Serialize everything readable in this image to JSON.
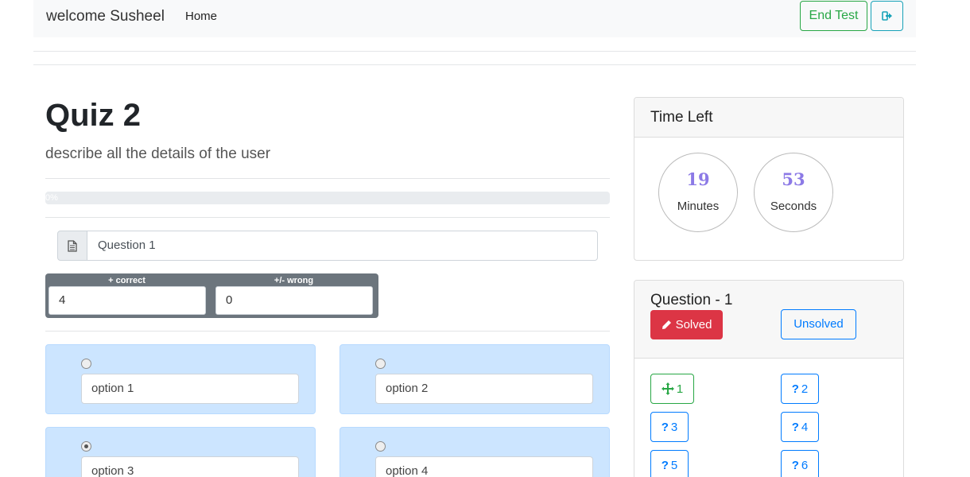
{
  "navbar": {
    "brand": "welcome Susheel",
    "home": "Home",
    "end_test": "End Test",
    "logout_icon": "sign-out-icon"
  },
  "quiz": {
    "title": "Quiz 2",
    "description": "describe all the details of the user",
    "progress_label": "0%",
    "progress_value": 0,
    "question_icon": "document-icon",
    "question_title": "Question 1",
    "correct_label": "+ correct",
    "correct_value": "4",
    "wrong_label": "+/- wrong",
    "wrong_value": "0",
    "options": [
      {
        "label": "option 1",
        "selected": false
      },
      {
        "label": "option 2",
        "selected": false
      },
      {
        "label": "option 3",
        "selected": true
      },
      {
        "label": "option 4",
        "selected": false
      }
    ]
  },
  "timer": {
    "title": "Time Left",
    "minutes": "19",
    "minutes_label": "Minutes",
    "seconds": "53",
    "seconds_label": "Seconds",
    "accent": "#8c7ae6"
  },
  "navigator": {
    "title": "Question - 1",
    "solved_label": "Solved",
    "unsolved_label": "Unsolved",
    "questions": [
      {
        "number": "1",
        "icon": "move-icon",
        "status": "current"
      },
      {
        "number": "2",
        "icon": "question-icon",
        "status": "unsolved"
      },
      {
        "number": "3",
        "icon": "question-icon",
        "status": "unsolved"
      },
      {
        "number": "4",
        "icon": "question-icon",
        "status": "unsolved"
      },
      {
        "number": "5",
        "icon": "question-icon",
        "status": "unsolved"
      },
      {
        "number": "6",
        "icon": "question-icon",
        "status": "unsolved"
      }
    ]
  },
  "colors": {
    "success": "#28a745",
    "info": "#17a2b8",
    "primary": "#007bff",
    "danger": "#dc3545",
    "option_bg": "#cce5ff"
  }
}
